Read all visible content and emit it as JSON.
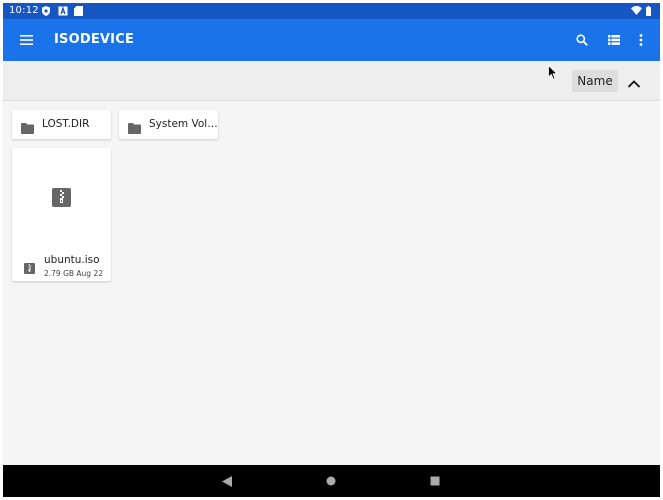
{
  "status_bar": {
    "time": "10:12",
    "left_icons": [
      "shield-icon",
      "sim-a-icon",
      "sd-card-icon"
    ],
    "right_icons": [
      "wifi-icon",
      "battery-icon"
    ]
  },
  "app_bar": {
    "title": "ISODEVICE",
    "menu_icon": "menu-icon",
    "actions": [
      "search-icon",
      "list-view-icon",
      "more-vert-icon"
    ],
    "background": "#1a73e8",
    "status_background": "#1557c2"
  },
  "sort": {
    "label": "Name",
    "direction_icon": "chevron-up-icon"
  },
  "folders": [
    {
      "name": "LOST.DIR"
    },
    {
      "name": "System Vol…"
    }
  ],
  "files": [
    {
      "name": "ubuntu.iso",
      "meta": "2.79 GB Aug 22",
      "icon": "archive-icon"
    }
  ],
  "nav_bar": {
    "buttons": [
      "back-icon",
      "home-icon",
      "recents-icon"
    ]
  }
}
